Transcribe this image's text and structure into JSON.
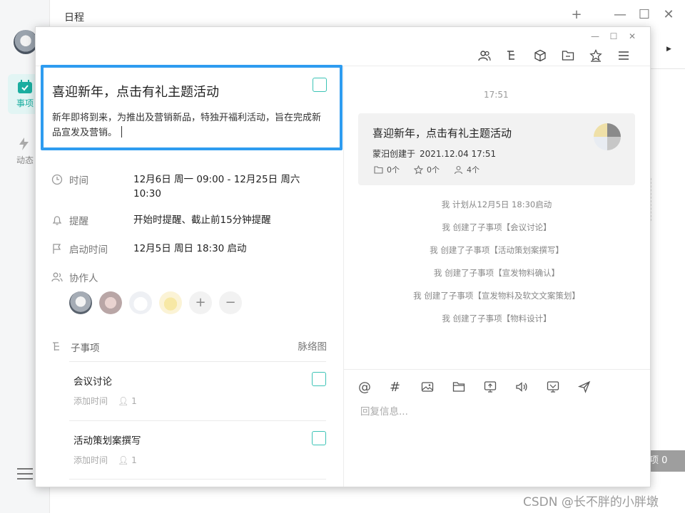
{
  "app": {
    "title": "日程",
    "nav": [
      {
        "label": "事项",
        "icon": "calendar-check-icon",
        "active": true
      },
      {
        "label": "动态",
        "icon": "activity-icon",
        "active": false
      }
    ],
    "badge_text": "项 0",
    "accent": "#1aaea0"
  },
  "watermark": "CSDN @长不胖的小胖墩",
  "dialog": {
    "toolbar": [
      "members-icon",
      "subtask-tree-icon",
      "cube-icon",
      "folder-icon",
      "star-icon",
      "menu-icon"
    ],
    "task": {
      "title": "喜迎新年，点击有礼主题活动",
      "description": "新年即将到来，为推出及营销新品，特独开福利活动，旨在完成新品宣发及营销。",
      "fields": [
        {
          "icon": "clock-icon",
          "label": "时间",
          "value": "12月6日 周一 09:00 - 12月25日 周六 10:30"
        },
        {
          "icon": "bell-icon",
          "label": "提醒",
          "value": "开始时提醒、截止前15分钟提醒"
        },
        {
          "icon": "flag-icon",
          "label": "启动时间",
          "value": "12月5日 周日 18:30 启动"
        },
        {
          "icon": "people-icon",
          "label": "协作人",
          "value": ""
        }
      ],
      "add_symbol": "+",
      "remove_symbol": "−",
      "subtasks_label": "子事项",
      "graph_label": "脉络图",
      "subtasks": [
        {
          "title": "会议讨论",
          "meta": "添加时间",
          "count": "1"
        },
        {
          "title": "活动策划案撰写",
          "meta": "添加时间",
          "count": "1"
        }
      ]
    },
    "chat": {
      "time": "17:51",
      "card": {
        "title": "喜迎新年，点击有礼主题活动",
        "creator": "蒙汨创建于",
        "created_at": "2021.12.04 17:51",
        "files": "0个",
        "stars": "0个",
        "members": "4个"
      },
      "logs": [
        "我 计划从12月5日 18:30启动",
        "我 创建了子事项【会议讨论】",
        "我 创建了子事项【活动策划案撰写】",
        "我 创建了子事项【宣发物料确认】",
        "我 创建了子事项【宣发物料及软文文案策划】",
        "我 创建了子事项【物料设计】"
      ],
      "input_tools": [
        "at-icon",
        "hash-icon",
        "image-icon",
        "folder-icon",
        "screen-share-icon",
        "voice-icon",
        "screenshot-icon",
        "send-icon"
      ],
      "at_symbol": "@",
      "hash_symbol": "#",
      "reply_placeholder": "回复信息..."
    }
  }
}
